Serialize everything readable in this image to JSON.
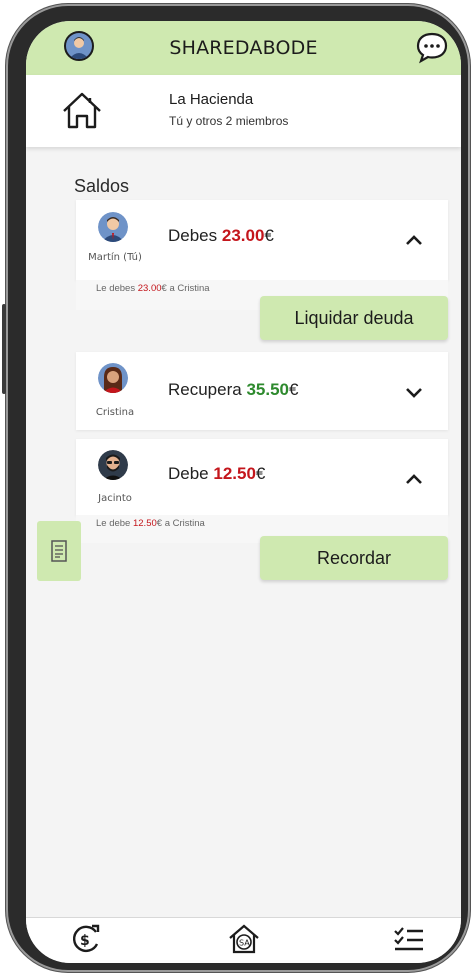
{
  "header": {
    "app_title": "SHAREDABODE",
    "profile_icon": "user-avatar-icon",
    "chat_icon": "chat-bubble-icon",
    "accent_color": "#cfe9b0"
  },
  "house": {
    "name": "La Hacienda",
    "members": "Tú y otros 2 miembros",
    "icon": "house-icon"
  },
  "balances": {
    "section_title": "Saldos",
    "items": [
      {
        "name": "Martín (Tú)",
        "label": "Debes ",
        "amount": "23.00",
        "currency": "€",
        "amount_color": "#c4161c",
        "expanded": true,
        "detail_prefix": "Le debes ",
        "detail_amount": "23.00",
        "detail_suffix": "€ a Cristina",
        "action_label": "Liquidar deuda"
      },
      {
        "name": "Cristina",
        "label": "Recupera ",
        "amount": "35.50",
        "currency": "€",
        "amount_color": "#2e8a2e",
        "expanded": false
      },
      {
        "name": "Jacinto",
        "label": "Debe ",
        "amount": "12.50",
        "currency": "€",
        "amount_color": "#c4161c",
        "expanded": true,
        "detail_prefix": "Le debe ",
        "detail_amount": "12.50",
        "detail_suffix": "€ a Cristina",
        "action_label": "Recordar"
      }
    ]
  },
  "side_tab": {
    "icon": "receipt-icon"
  },
  "nav": {
    "left_icon": "money-exchange-icon",
    "center_icon": "home-sa-icon",
    "right_icon": "checklist-icon"
  }
}
